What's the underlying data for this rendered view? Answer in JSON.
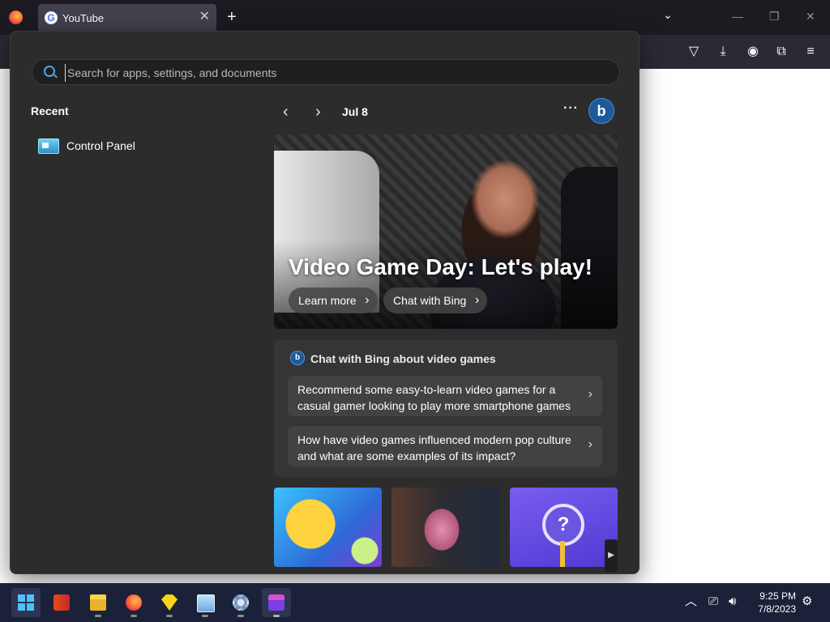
{
  "browser": {
    "tab": {
      "title": "YouTube",
      "favicon": "google-icon"
    },
    "controls": [
      "new-tab-icon",
      "list-all-tabs-icon",
      "minimize-icon",
      "restore-icon",
      "close-icon"
    ],
    "toolbar_icons": [
      "pocket-icon",
      "download-icon",
      "account-icon",
      "extensions-icon",
      "menu-icon"
    ]
  },
  "start_menu": {
    "search": {
      "placeholder": "Search for apps, settings, and documents",
      "value": ""
    },
    "recent": {
      "heading": "Recent",
      "items": [
        {
          "label": "Control Panel",
          "icon": "control-panel-icon"
        }
      ]
    },
    "feed": {
      "date": "Jul 8",
      "more": "···",
      "bing_logo": "b",
      "hero": {
        "headline": "Video Game Day: Let's play!",
        "learn_more": "Learn more",
        "chat": "Chat with Bing"
      },
      "chat_box": {
        "heading": "Chat with Bing about video games",
        "suggestions": [
          "Recommend some easy-to-learn video games for a casual gamer looking to play more smartphone games",
          "How have video games influenced modern pop culture and what are some examples of its impact?"
        ]
      },
      "thumbnails": [
        "game-thumbnail",
        "gamer-thumbnail",
        "quiz-thumbnail"
      ]
    }
  },
  "taskbar": {
    "apps": [
      "start",
      "office",
      "file-explorer",
      "firefox",
      "gem-app",
      "photos",
      "settings",
      "video-editor"
    ],
    "clock": {
      "time": "9:25 PM",
      "date": "7/8/2023"
    }
  },
  "colors": {
    "accent": "#4cc2ff",
    "taskbar": "#1a2138",
    "menu_bg": "#2c2c2c"
  }
}
